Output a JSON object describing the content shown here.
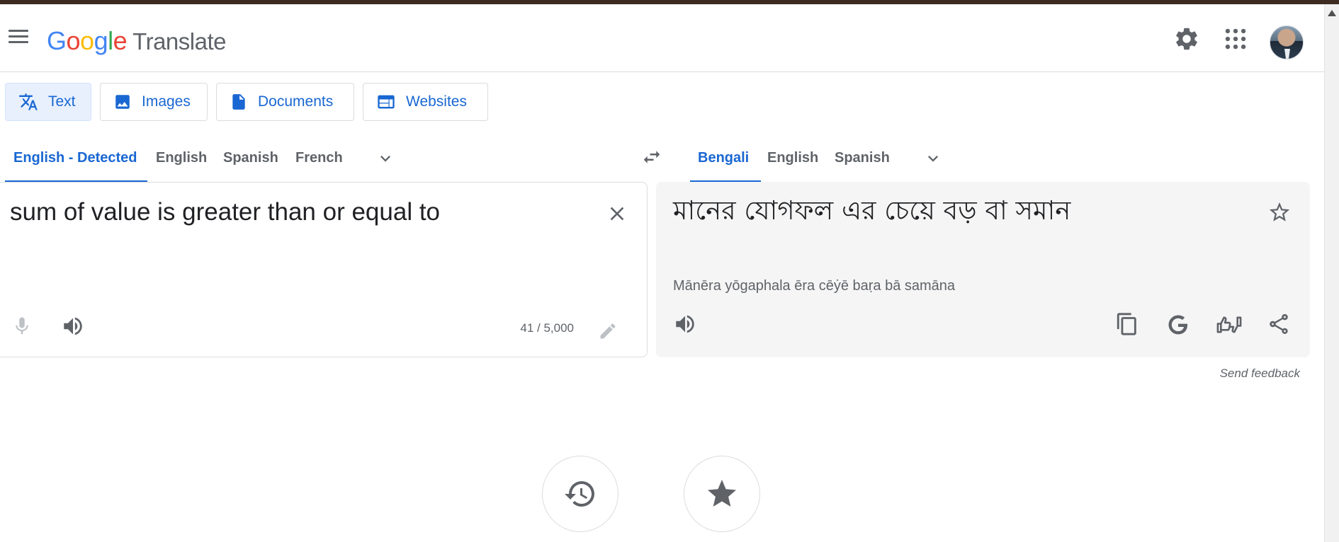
{
  "app": {
    "logo_letters": [
      "G",
      "o",
      "o",
      "g",
      "l",
      "e"
    ],
    "product_name": "Translate"
  },
  "header": {
    "icons": [
      "menu-icon",
      "settings-icon",
      "apps-grid-icon",
      "account-avatar"
    ]
  },
  "modes": [
    {
      "label": "Text",
      "icon": "translate-icon",
      "active": true
    },
    {
      "label": "Images",
      "icon": "image-icon",
      "active": false
    },
    {
      "label": "Documents",
      "icon": "document-icon",
      "active": false
    },
    {
      "label": "Websites",
      "icon": "website-icon",
      "active": false
    }
  ],
  "source_langs": [
    {
      "label": "English - Detected",
      "active": true
    },
    {
      "label": "English",
      "active": false
    },
    {
      "label": "Spanish",
      "active": false
    },
    {
      "label": "French",
      "active": false
    }
  ],
  "target_langs": [
    {
      "label": "Bengali",
      "active": true
    },
    {
      "label": "English",
      "active": false
    },
    {
      "label": "Spanish",
      "active": false
    }
  ],
  "source": {
    "text": "sum of value is greater than or equal to",
    "char_count": "41 / 5,000"
  },
  "target": {
    "text": "মানের যোগফল এর চেয়ে বড় বা সমান",
    "transliteration": "Mānēra yōgaphala ēra cēẏē baṛa bā samāna"
  },
  "feedback_label": "Send feedback",
  "colors": {
    "accent": "#1967d2",
    "active_mode_bg": "#e8f0fe",
    "target_panel_bg": "#f5f5f5",
    "icon_gray": "#5f6368"
  }
}
